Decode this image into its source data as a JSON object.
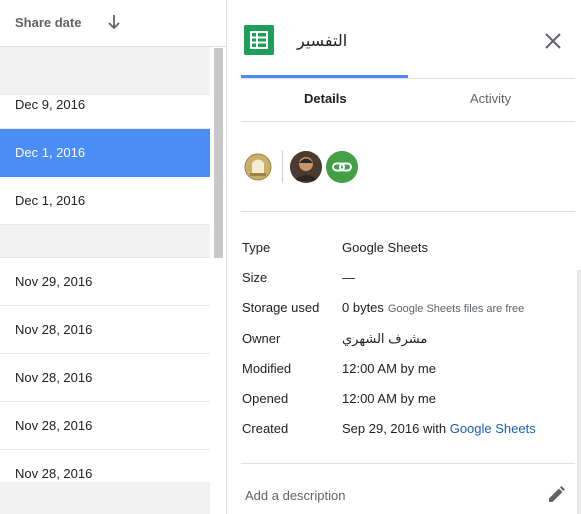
{
  "list": {
    "column_header": "Share date",
    "rows": [
      "Dec 9, 2016",
      "Dec 1, 2016",
      "Dec 1, 2016",
      "Nov 29, 2016",
      "Nov 28, 2016",
      "Nov 28, 2016",
      "Nov 28, 2016",
      "Nov 28, 2016"
    ],
    "selected_index": 1
  },
  "details": {
    "file_title": "التفسير",
    "tabs": [
      "Details",
      "Activity"
    ],
    "props": {
      "type_label": "Type",
      "type_value": "Google Sheets",
      "size_label": "Size",
      "size_value": "—",
      "storage_label": "Storage used",
      "storage_value": "0 bytes",
      "storage_note": "Google Sheets files are free",
      "owner_label": "Owner",
      "owner_value": "مشرف الشهري",
      "modified_label": "Modified",
      "modified_value": "12:00 AM by me",
      "opened_label": "Opened",
      "opened_value": "12:00 AM by me",
      "created_label": "Created",
      "created_value": "Sep 29, 2016 with",
      "created_link": "Google Sheets"
    },
    "add_description": "Add a description"
  },
  "colors": {
    "accent": "#4c8cf5",
    "sheets_green": "#1e9e5a",
    "link_green": "#43a047"
  },
  "icons": [
    "arrow-down-icon",
    "sheets-icon",
    "close-icon",
    "link-icon",
    "pencil-icon"
  ]
}
